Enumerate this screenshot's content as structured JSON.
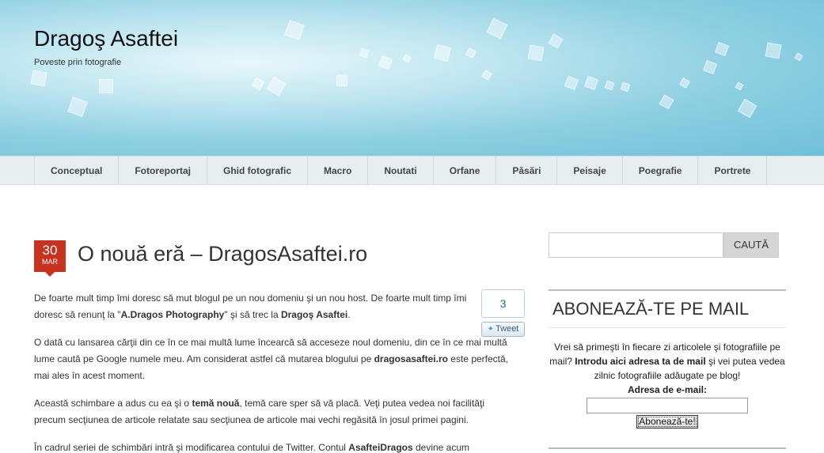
{
  "site": {
    "title": "Dragoş Asaftei",
    "tagline": "Poveste prin fotografie"
  },
  "nav": {
    "items": [
      "Conceptual",
      "Fotoreportaj",
      "Ghid fotografic",
      "Macro",
      "Noutati",
      "Orfane",
      "Păsări",
      "Peisaje",
      "Poegrafie",
      "Portrete"
    ]
  },
  "post": {
    "day": "30",
    "month": "MAR",
    "title": "O nouă eră – DragosAsaftei.ro",
    "tweet_count": "3",
    "tweet_label": "Tweet",
    "paragraphs": {
      "p1_a": "De foarte mult timp îmi doresc să mut blogul pe un nou domeniu şi un nou host. De foarte mult timp îmi doresc să renunţ la \"",
      "p1_b": "A.Dragos Photography",
      "p1_c": "\" şi să trec la ",
      "p1_d": "Dragoş Asaftei",
      "p1_e": ".",
      "p2_a": "O dată cu lansarea cărţii din ce în ce mai multă lume încearcă să acceseze noul domeniu, din ce în ce mai multă lume caută pe Google numele meu. Am considerat astfel că mutarea blogului pe ",
      "p2_b": "dragosasaftei.ro",
      "p2_c": " este perfectă, mai ales în acest moment.",
      "p3_a": "Această schimbare a adus cu ea şi o ",
      "p3_b": "temă nouă",
      "p3_c": ", temă care sper să vă placă. Veţi putea vedea noi facilităţi precum secţiunea de articole relatate sau secţiunea de articole mai vechi regăsită în josul primei pagini.",
      "p4_a": "În cadrul seriei de schimbări intră şi modificarea contului de Twitter. Contul ",
      "p4_b": "AsafteiDragos",
      "p4_c": " devine acum"
    }
  },
  "sidebar": {
    "search_button": "CAUTĂ",
    "search_placeholder": "",
    "widget_title": "ABONEAZĂ-TE PE MAIL",
    "text_a": "Vrei să primeşti în fiecare zi articolele şi fotografiile pe mail? ",
    "text_b": "Introdu aici adresa ta de mail",
    "text_c": " şi vei putea vedea zilnic fotografiile adăugate pe blog!",
    "email_label": "Adresa de e-mail:",
    "email_value": "",
    "subscribe_button": "Abonează-te!"
  }
}
